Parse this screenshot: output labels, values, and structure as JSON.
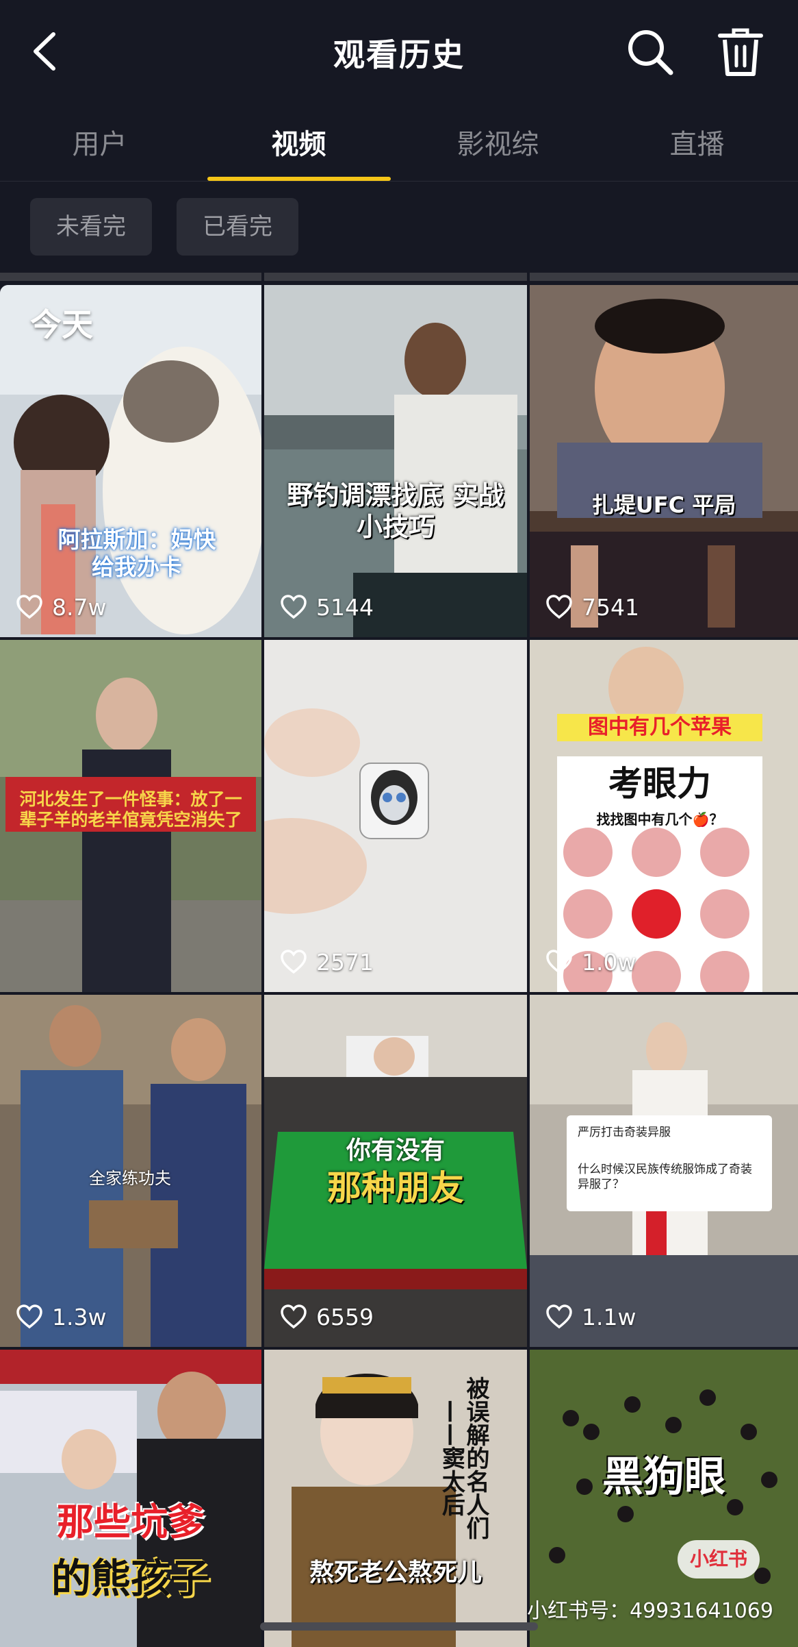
{
  "header": {
    "title": "观看历史",
    "back_icon": "chevron-left-icon",
    "search_icon": "search-icon",
    "trash_icon": "trash-icon"
  },
  "tabs": [
    {
      "label": "用户",
      "active": false
    },
    {
      "label": "视频",
      "active": true
    },
    {
      "label": "影视综",
      "active": false
    },
    {
      "label": "直播",
      "active": false
    }
  ],
  "accent_color": "#f5c518",
  "filters": [
    {
      "label": "未看完"
    },
    {
      "label": "已看完"
    }
  ],
  "section_label": "今天",
  "videos": [
    {
      "likes": "8.7w",
      "caption": "阿拉斯加：妈快给我办卡"
    },
    {
      "likes": "5144",
      "caption": "野钓调漂找底 实战小技巧"
    },
    {
      "likes": "7541",
      "caption": "扎堤UFC 平局"
    },
    {
      "likes": "",
      "caption": "河北发生了一件怪事：放了一辈子羊的老羊倌竟凭空消失了"
    },
    {
      "likes": "2571",
      "caption": ""
    },
    {
      "likes": "1.0w",
      "caption": "图中有几个苹果",
      "caption2": "考眼力",
      "caption3": "找找图中有几个🍎？"
    },
    {
      "likes": "1.3w",
      "caption": "全家练功夫"
    },
    {
      "likes": "6559",
      "caption": "你有没有",
      "caption2": "那种朋友"
    },
    {
      "likes": "1.1w",
      "caption": "严厉打击奇装异服",
      "caption2": "什么时候汉民族传统服饰成了奇装异服了？"
    },
    {
      "likes": "",
      "caption": "那些坑爹",
      "caption2": "的熊孩子"
    },
    {
      "likes": "",
      "caption": "熬死老公熬死儿",
      "caption2": "被误解的名人们——窦太后"
    },
    {
      "likes": "",
      "caption": "黑狗眼"
    }
  ],
  "watermark": {
    "logo": "小红书",
    "text": "小红书号：4993164​1069"
  }
}
